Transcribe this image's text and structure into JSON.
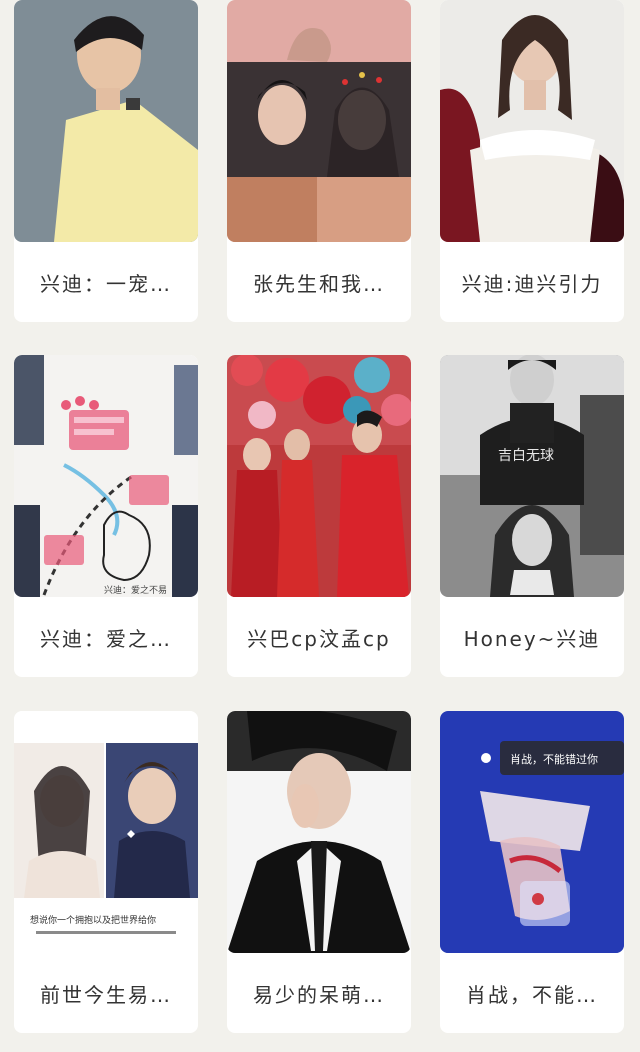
{
  "cards": [
    {
      "title": "兴迪：一宠…"
    },
    {
      "title": "张先生和我…"
    },
    {
      "title": "兴迪:迪兴引力"
    },
    {
      "title": "兴迪：爱之…",
      "overlay": "兴迪：爱之不易"
    },
    {
      "title": "兴巴cp汶孟cp"
    },
    {
      "title": "Honey~兴迪",
      "overlay": "吉白无球"
    },
    {
      "title": "前世今生易…",
      "overlay": "想说你一个拥抱以及把世界给你"
    },
    {
      "title": "易少的呆萌…"
    },
    {
      "title": "肖战，不能…",
      "overlay": "肖战，不能错过你"
    }
  ]
}
